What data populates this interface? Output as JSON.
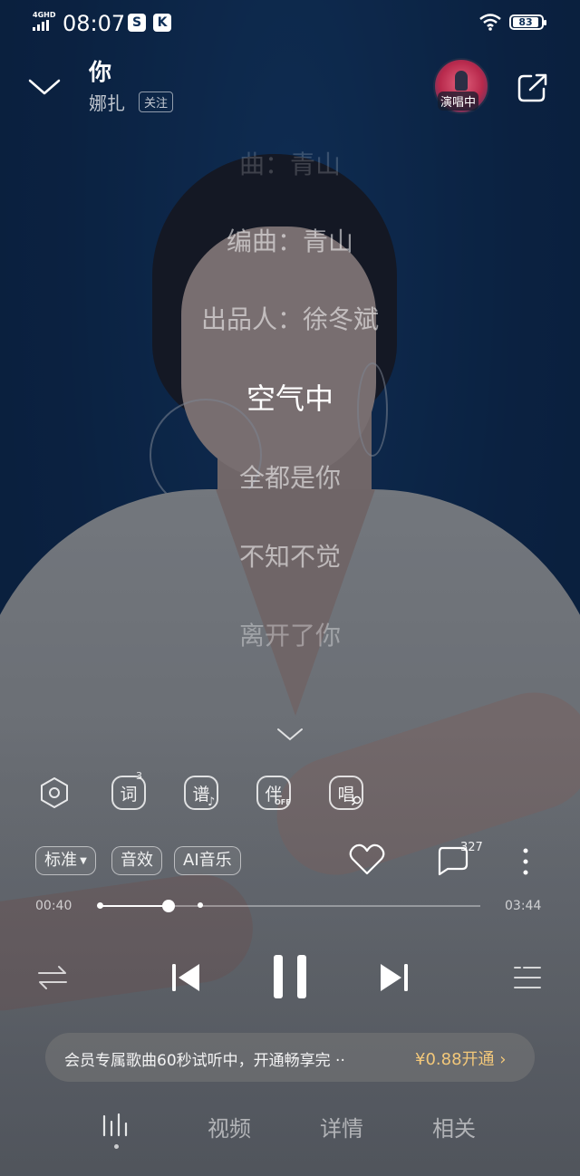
{
  "status_bar": {
    "network": "4GHD",
    "time": "08:07",
    "app_icons": [
      "soul-app-icon",
      "kuwo-app-icon"
    ],
    "battery": "83"
  },
  "header": {
    "song_title": "你",
    "artist": "娜扎",
    "follow_label": "关注",
    "singing_badge": "演唱中"
  },
  "lyrics": {
    "lines": [
      {
        "text": "曲：青山",
        "current": false
      },
      {
        "text": "编曲：青山",
        "current": false
      },
      {
        "text": "出品人：徐冬斌",
        "current": false
      },
      {
        "text": "空气中",
        "current": true
      },
      {
        "text": "全都是你",
        "current": false
      },
      {
        "text": "不知不觉",
        "current": false
      },
      {
        "text": "离开了你",
        "current": false
      }
    ]
  },
  "tools": [
    {
      "name": "sound-effect-button",
      "label": "",
      "sup": ""
    },
    {
      "name": "lyrics-tool-button",
      "label": "词",
      "sup": "3"
    },
    {
      "name": "sheet-music-button",
      "label": "谱",
      "sup": "♪"
    },
    {
      "name": "accompaniment-button",
      "label": "伴",
      "sup": "OFF"
    },
    {
      "name": "karaoke-button",
      "label": "唱",
      "sup": "🎤"
    }
  ],
  "options": {
    "quality": "标准",
    "effects": "音效",
    "ai_music": "AI音乐"
  },
  "social": {
    "comment_count": "327"
  },
  "progress": {
    "elapsed": "00:40",
    "total": "03:44",
    "played_fraction": 0.18,
    "buffer_fraction": 0.265
  },
  "vip_banner": {
    "message": "会员专属歌曲60秒试听中，开通畅享完 ··",
    "cta": "¥0.88开通 ›"
  },
  "tabs": [
    "视频",
    "详情",
    "相关"
  ],
  "colors": {
    "background": "#0d2e57",
    "vip_accent": "#f3c87a"
  }
}
